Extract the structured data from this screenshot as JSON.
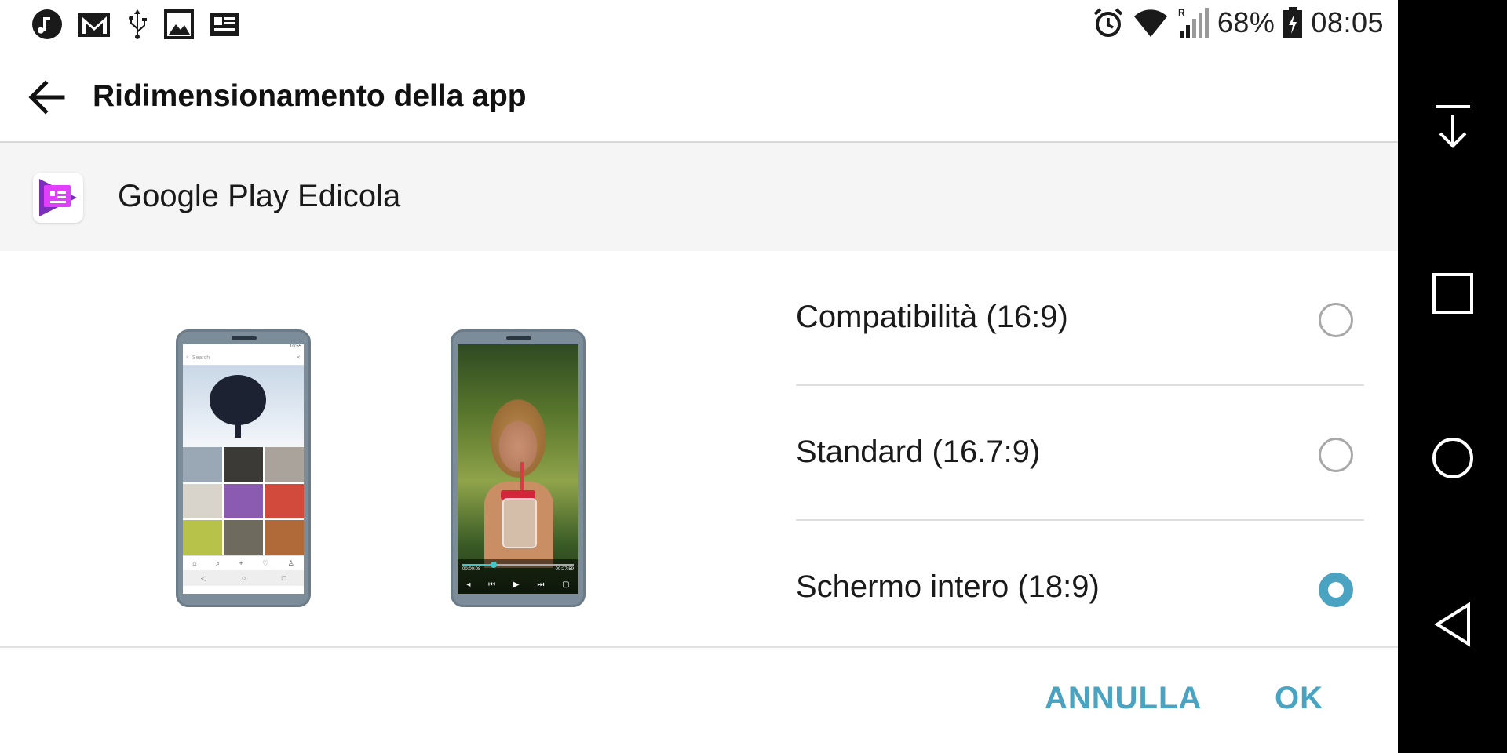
{
  "status_bar": {
    "left_icons": [
      "music-note-icon",
      "gmail-icon",
      "usb-icon",
      "image-icon",
      "news-icon"
    ],
    "right_icons": [
      "alarm-icon",
      "wifi-icon",
      "signal-icon",
      "battery-icon"
    ],
    "roaming_mark": "R",
    "battery": "68%",
    "time": "08:05"
  },
  "app_bar": {
    "title": "Ridimensionamento della app"
  },
  "app": {
    "name": "Google Play Edicola"
  },
  "preview": {
    "gallery_search_placeholder": "Search",
    "gallery_clock": "10:55",
    "video_elapsed": "00:00:08",
    "video_total": "00:27:59",
    "video_progress": 0.28
  },
  "options": [
    {
      "label": "Compatibilità (16:9)",
      "selected": false
    },
    {
      "label": "Standard (16.7:9)",
      "selected": false
    },
    {
      "label": "Schermo intero (18:9)",
      "selected": true
    }
  ],
  "footer": {
    "cancel_label": "ANNULLA",
    "ok_label": "OK"
  },
  "nav": {
    "icons": [
      "notification-pull-icon",
      "recents-icon",
      "home-icon",
      "back-icon"
    ]
  },
  "colors": {
    "accent": "#4aa3c0",
    "header_bg": "#f5f5f5",
    "nav_bg": "#000000"
  }
}
